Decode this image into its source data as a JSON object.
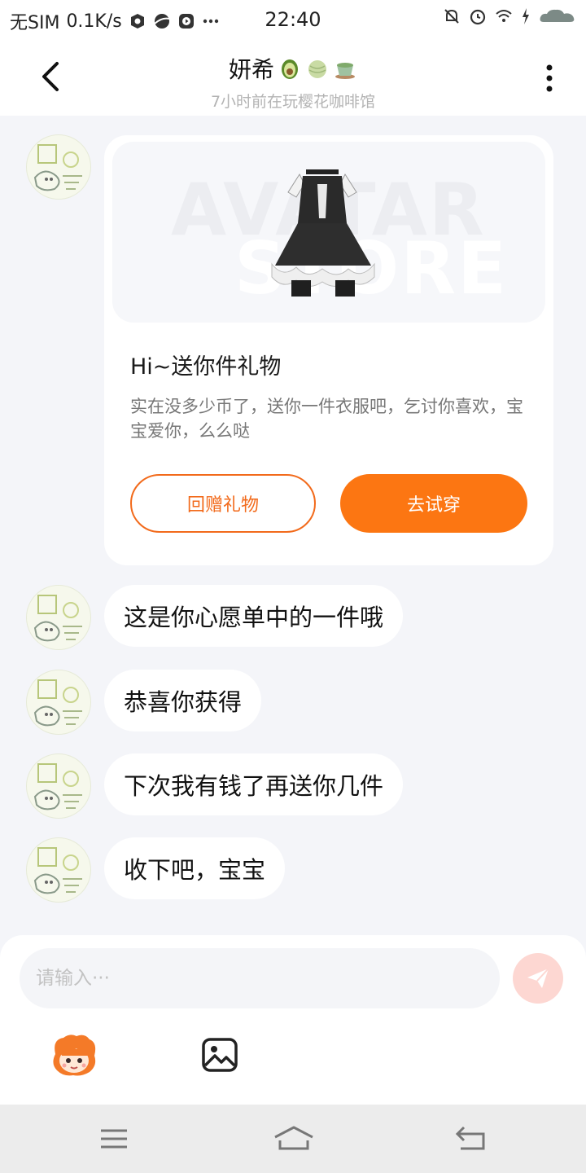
{
  "status_bar": {
    "sim": "无SIM",
    "speed": "0.1K/s",
    "time": "22:40"
  },
  "header": {
    "title": "妍希",
    "title_emojis": [
      "avocado-emoji",
      "melon-emoji",
      "tea-emoji"
    ],
    "subtitle": "7小时前在玩樱花咖啡馆"
  },
  "gift_card": {
    "image_watermark_line1": "AVATAR",
    "image_watermark_line2": "STORE",
    "title": "Hi~送你件礼物",
    "description": "实在没多少币了，送你一件衣服吧，乞讨你喜欢，宝宝爱你，么么哒",
    "return_gift_label": "回赠礼物",
    "try_on_label": "去试穿"
  },
  "messages": [
    {
      "text": "这是你心愿单中的一件哦"
    },
    {
      "text": "恭喜你获得"
    },
    {
      "text": "下次我有钱了再送你几件"
    },
    {
      "text": "收下吧，宝宝"
    }
  ],
  "composer": {
    "placeholder": "请输入···"
  },
  "colors": {
    "accent": "#fc7612",
    "send_disabled": "#fdd7d2",
    "background": "#f4f5f9"
  }
}
